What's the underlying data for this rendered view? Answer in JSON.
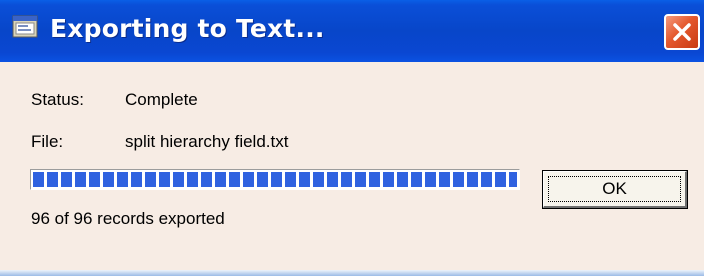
{
  "window": {
    "title": "Exporting to Text...",
    "icon": "window-app-icon",
    "close_icon": "close-icon",
    "accent_color": "#0846c9",
    "close_color": "#e4582d"
  },
  "content": {
    "status_label": "Status:",
    "status_value": "Complete",
    "file_label": "File:",
    "file_value": "split hierarchy field.txt",
    "progress_fraction": 1.0,
    "progress_color": "#2f62e0",
    "records_text": "96 of 96 records exported"
  },
  "buttons": {
    "ok_label": "OK"
  }
}
